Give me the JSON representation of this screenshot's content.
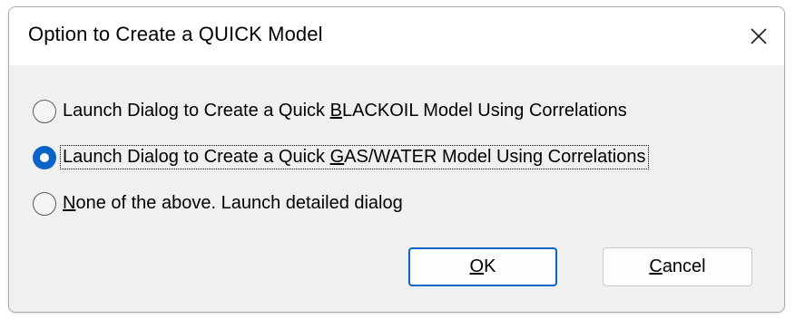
{
  "dialog": {
    "title": "Option to Create a QUICK Model",
    "close_icon": "close-icon"
  },
  "options": [
    {
      "pre": "Launch Dialog to Create a Quick ",
      "mnemonic": "B",
      "post": "LACKOIL Model Using Correlations",
      "checked": false
    },
    {
      "pre": "Launch Dialog to Create a Quick ",
      "mnemonic": "G",
      "post": "AS/WATER Model Using Correlations",
      "checked": true
    },
    {
      "pre": "",
      "mnemonic": "N",
      "post": "one of the above. Launch detailed dialog",
      "checked": false
    }
  ],
  "buttons": {
    "ok": {
      "mnemonic": "O",
      "rest": "K"
    },
    "cancel": {
      "mnemonic": "C",
      "rest": "ancel"
    }
  },
  "colors": {
    "accent": "#0a64c8",
    "dialog_bg": "#f0f0f0",
    "titlebar_bg": "#ffffff"
  }
}
